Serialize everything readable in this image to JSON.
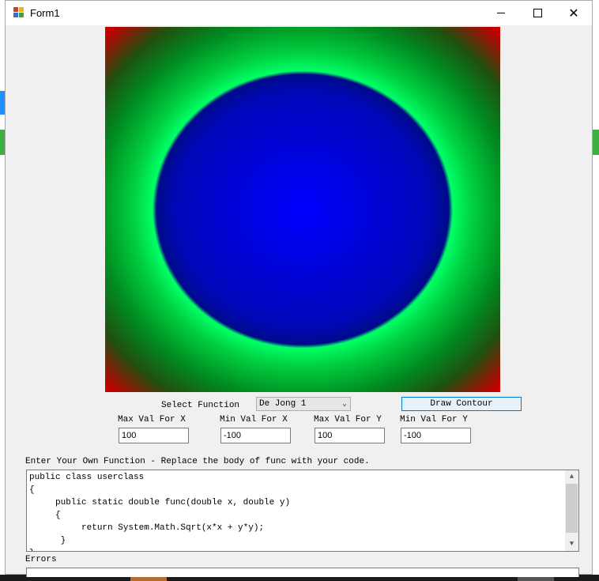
{
  "window": {
    "title": "Form1"
  },
  "controls": {
    "select_function_label": "Select Function",
    "function_selected": "De Jong 1",
    "draw_button": "Draw Contour",
    "max_x_label": "Max Val For X",
    "min_x_label": "Min Val For X",
    "max_y_label": "Max Val For Y",
    "min_y_label": "Min Val For Y",
    "max_x_value": "100",
    "min_x_value": "-100",
    "max_y_value": "100",
    "min_y_value": "-100"
  },
  "code": {
    "label": "Enter Your Own Function - Replace the body of func with your code.",
    "lines": [
      "public class userclass",
      "{",
      "     public static double func(double x, double y)",
      "     {",
      "          return System.Math.Sqrt(x*x + y*y);",
      "      }",
      "}"
    ]
  },
  "errors": {
    "label": "Errors"
  },
  "colors": {
    "contour_center": "#0000ff",
    "contour_ring": "#00ff66",
    "contour_corner": "#ff0000"
  }
}
